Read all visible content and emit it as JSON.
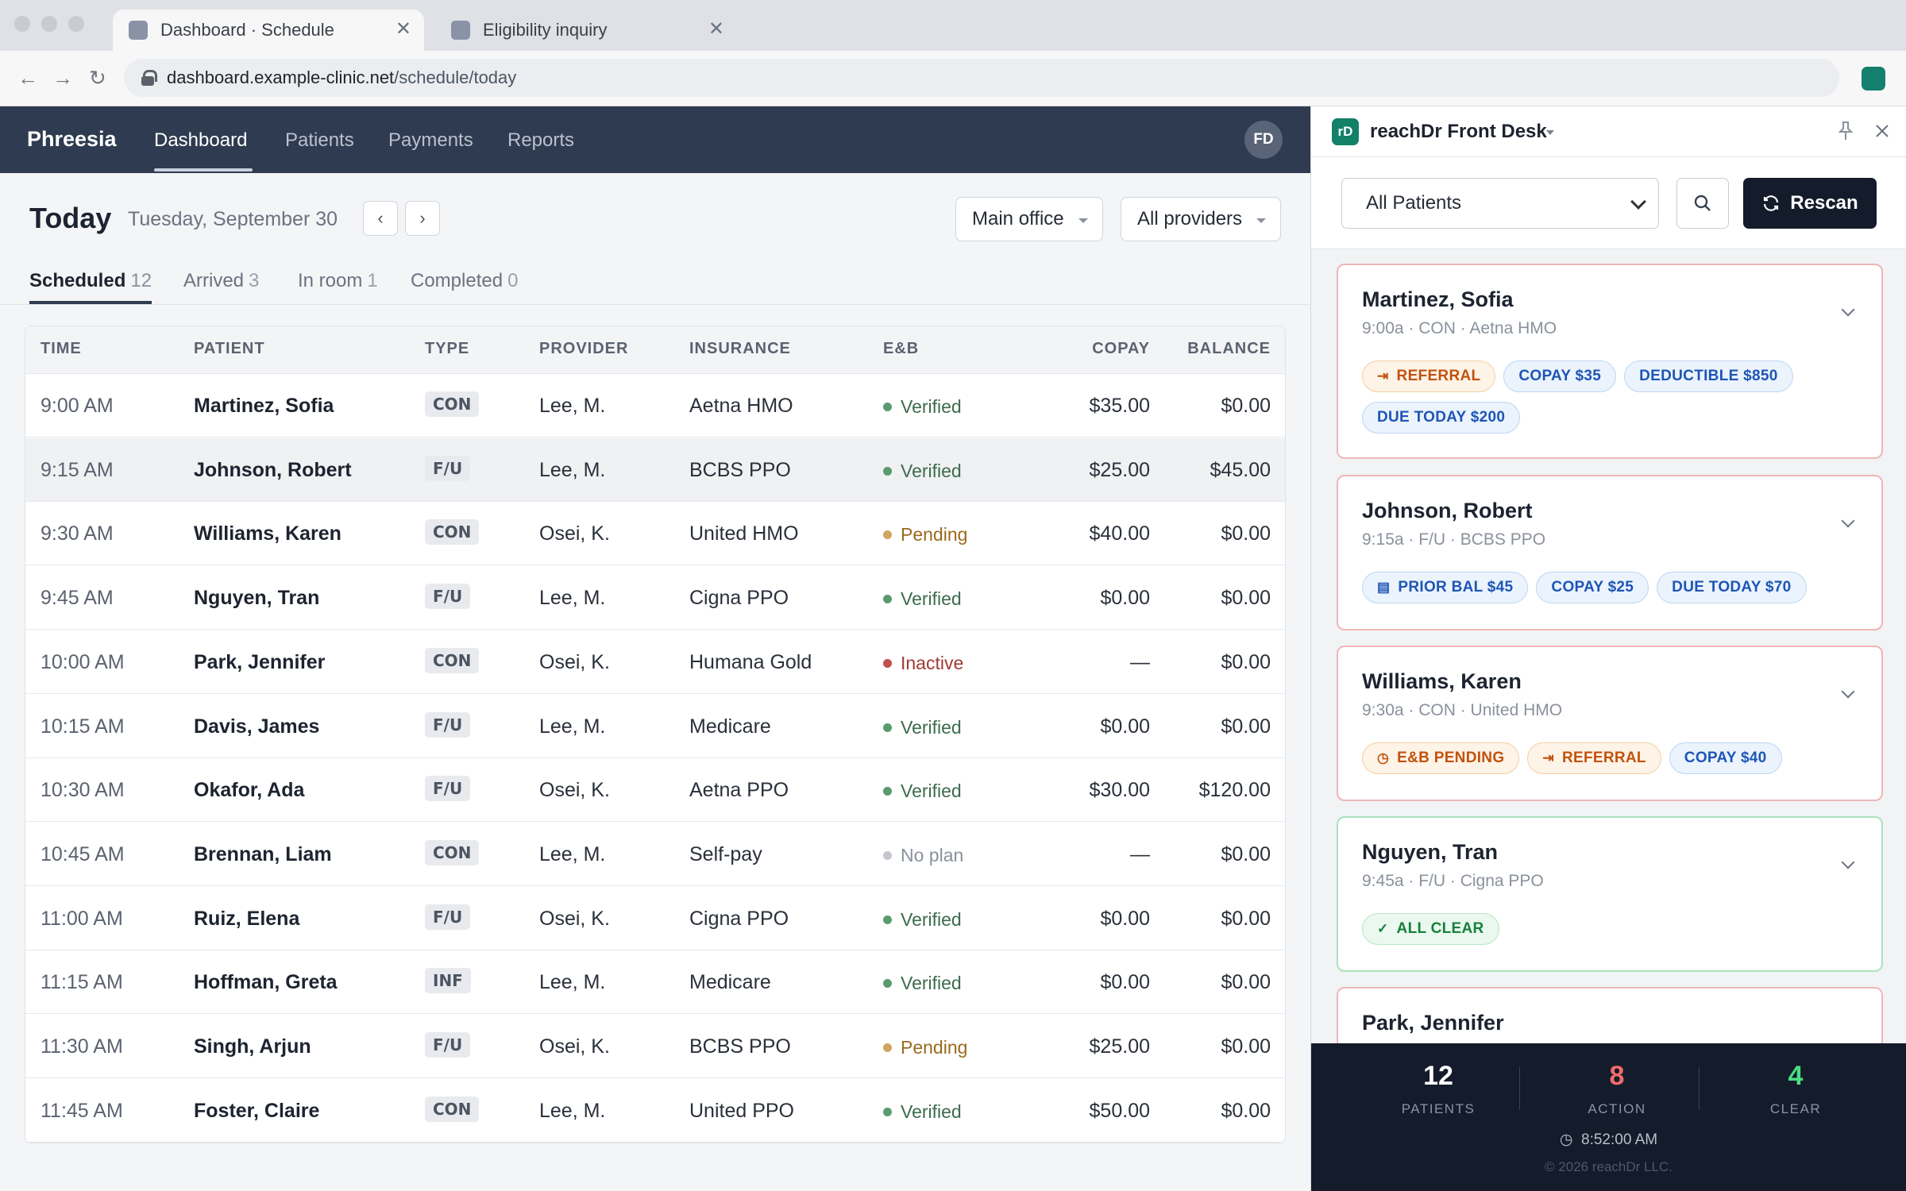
{
  "browser": {
    "tabs": [
      {
        "title": "Dashboard · Schedule"
      },
      {
        "title": "Eligibility inquiry"
      }
    ],
    "url_host": "dashboard.example-clinic.net",
    "url_path": "/schedule/today"
  },
  "app": {
    "brand": "Phreesia",
    "nav": [
      "Dashboard",
      "Patients",
      "Payments",
      "Reports"
    ],
    "avatar_initials": "FD"
  },
  "main": {
    "title": "Today",
    "date": "Tuesday, September 30",
    "office_filter": "Main office",
    "provider_filter": "All providers",
    "subtabs": [
      {
        "label": "Scheduled",
        "count": "12"
      },
      {
        "label": "Arrived",
        "count": "3"
      },
      {
        "label": "In room",
        "count": "1"
      },
      {
        "label": "Completed",
        "count": "0"
      }
    ],
    "columns": [
      "TIME",
      "PATIENT",
      "TYPE",
      "PROVIDER",
      "INSURANCE",
      "E&B",
      "COPAY",
      "BALANCE"
    ],
    "rows": [
      {
        "time": "9:00 AM",
        "patient": "Martinez, Sofia",
        "type": "CON",
        "provider": "Lee, M.",
        "insurance": "Aetna HMO",
        "eb": "Verified",
        "copay": "$35.00",
        "balance": "$0.00"
      },
      {
        "time": "9:15 AM",
        "patient": "Johnson, Robert",
        "type": "F/U",
        "provider": "Lee, M.",
        "insurance": "BCBS PPO",
        "eb": "Verified",
        "copay": "$25.00",
        "balance": "$45.00"
      },
      {
        "time": "9:30 AM",
        "patient": "Williams, Karen",
        "type": "CON",
        "provider": "Osei, K.",
        "insurance": "United HMO",
        "eb": "Pending",
        "copay": "$40.00",
        "balance": "$0.00"
      },
      {
        "time": "9:45 AM",
        "patient": "Nguyen, Tran",
        "type": "F/U",
        "provider": "Lee, M.",
        "insurance": "Cigna PPO",
        "eb": "Verified",
        "copay": "$0.00",
        "balance": "$0.00"
      },
      {
        "time": "10:00 AM",
        "patient": "Park, Jennifer",
        "type": "CON",
        "provider": "Osei, K.",
        "insurance": "Humana Gold",
        "eb": "Inactive",
        "copay": "—",
        "balance": "$0.00"
      },
      {
        "time": "10:15 AM",
        "patient": "Davis, James",
        "type": "F/U",
        "provider": "Lee, M.",
        "insurance": "Medicare",
        "eb": "Verified",
        "copay": "$0.00",
        "balance": "$0.00"
      },
      {
        "time": "10:30 AM",
        "patient": "Okafor, Ada",
        "type": "F/U",
        "provider": "Osei, K.",
        "insurance": "Aetna PPO",
        "eb": "Verified",
        "copay": "$30.00",
        "balance": "$120.00"
      },
      {
        "time": "10:45 AM",
        "patient": "Brennan, Liam",
        "type": "CON",
        "provider": "Lee, M.",
        "insurance": "Self-pay",
        "eb": "No plan",
        "copay": "—",
        "balance": "$0.00"
      },
      {
        "time": "11:00 AM",
        "patient": "Ruiz, Elena",
        "type": "F/U",
        "provider": "Osei, K.",
        "insurance": "Cigna PPO",
        "eb": "Verified",
        "copay": "$0.00",
        "balance": "$0.00"
      },
      {
        "time": "11:15 AM",
        "patient": "Hoffman, Greta",
        "type": "INF",
        "provider": "Lee, M.",
        "insurance": "Medicare",
        "eb": "Verified",
        "copay": "$0.00",
        "balance": "$0.00"
      },
      {
        "time": "11:30 AM",
        "patient": "Singh, Arjun",
        "type": "F/U",
        "provider": "Osei, K.",
        "insurance": "BCBS PPO",
        "eb": "Pending",
        "copay": "$25.00",
        "balance": "$0.00"
      },
      {
        "time": "11:45 AM",
        "patient": "Foster, Claire",
        "type": "CON",
        "provider": "Lee, M.",
        "insurance": "United PPO",
        "eb": "Verified",
        "copay": "$50.00",
        "balance": "$0.00"
      }
    ],
    "eb_colors": {
      "Verified": {
        "dot": "#5a9b6e",
        "text": "#3d6b4d"
      },
      "Pending": {
        "dot": "#d0a560",
        "text": "#9a6a1c"
      },
      "Inactive": {
        "dot": "#c0504d",
        "text": "#a13a36"
      },
      "No plan": {
        "dot": "#c4c8ce",
        "text": "#8a919c"
      }
    }
  },
  "panel": {
    "logo": "rD",
    "title": "reachDr Front Desk",
    "patient_filter": "All Patients",
    "rescan_label": "Rescan",
    "cards": [
      {
        "name": "Martinez, Sofia",
        "meta": "9:00a · CON · Aetna HMO",
        "status": "action",
        "tags": [
          {
            "label": "REFERRAL",
            "style": "orange",
            "icon": "referral-icon"
          },
          {
            "label": "COPAY $35",
            "style": "blue"
          },
          {
            "label": "DEDUCTIBLE $850",
            "style": "blue"
          },
          {
            "label": "DUE TODAY $200",
            "style": "blue"
          }
        ]
      },
      {
        "name": "Johnson, Robert",
        "meta": "9:15a · F/U · BCBS PPO",
        "status": "action",
        "tags": [
          {
            "label": "PRIOR BAL $45",
            "style": "blue",
            "icon": "document-icon"
          },
          {
            "label": "COPAY $25",
            "style": "blue"
          },
          {
            "label": "DUE TODAY $70",
            "style": "blue"
          }
        ]
      },
      {
        "name": "Williams, Karen",
        "meta": "9:30a · CON · United HMO",
        "status": "action",
        "tags": [
          {
            "label": "E&B PENDING",
            "style": "orange",
            "icon": "clock-icon"
          },
          {
            "label": "REFERRAL",
            "style": "orange",
            "icon": "referral-icon"
          },
          {
            "label": "COPAY $40",
            "style": "blue"
          }
        ]
      },
      {
        "name": "Nguyen, Tran",
        "meta": "9:45a · F/U · Cigna PPO",
        "status": "clear",
        "tags": [
          {
            "label": "ALL CLEAR",
            "style": "green",
            "icon": "check-icon"
          }
        ]
      },
      {
        "name": "Park, Jennifer",
        "meta": "",
        "status": "action",
        "tags": []
      }
    ],
    "stats": [
      {
        "value": "12",
        "label": "PATIENTS",
        "color": "#ffffff"
      },
      {
        "value": "8",
        "label": "ACTION",
        "color": "#f26b6b"
      },
      {
        "value": "4",
        "label": "CLEAR",
        "color": "#4ade80"
      }
    ],
    "time": "8:52:00 AM",
    "copyright": "© 2026 reachDr LLC."
  }
}
